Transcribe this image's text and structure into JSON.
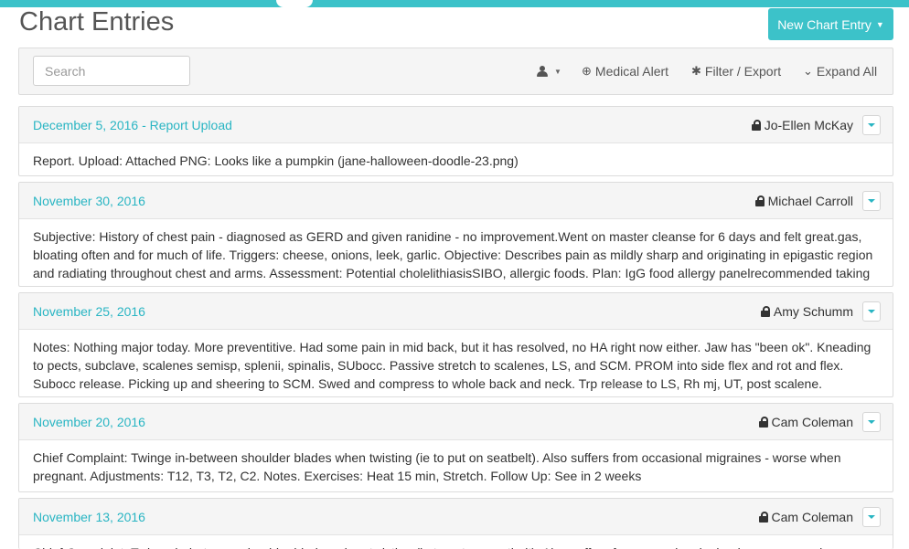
{
  "header": {
    "title": "Chart Entries",
    "new_entry_label": "New Chart Entry"
  },
  "toolbar": {
    "search_placeholder": "Search",
    "user_filter_icon": "user-icon",
    "medical_alert_label": "Medical Alert",
    "filter_export_label": "Filter / Export",
    "expand_all_label": "Expand All"
  },
  "colors": {
    "accent": "#3cc2c9",
    "link": "#29b5c3"
  },
  "entries": [
    {
      "date": "December 5, 2016 - Report Upload",
      "author": "Jo-Ellen McKay",
      "body": "Report. Upload: Attached PNG: Looks like a pumpkin (jane-halloween-doodle-23.png)"
    },
    {
      "date": "November 30, 2016",
      "author": "Michael Carroll",
      "body": "Subjective: History of chest pain - diagnosed as GERD and given ranidine - no improvement.Went on master cleanse for 6 days and felt great.gas, bloating often and for much of life. Triggers: cheese, onions, leek, garlic. Objective: Describes pain as mildly sharp and originating in epigastic region and radiating throughout chest and arms. Assessment: Potential cholelithiasisSIBO, allergic foods. Plan: IgG food allergy panelrecommended taking"
    },
    {
      "date": "November 25, 2016",
      "author": "Amy Schumm",
      "body": "Notes: Nothing major today. More preventitive. Had some pain in mid back, but it has resolved, no HA right now either. Jaw has \"been ok\". Kneading to pects, subclave, scalenes semisp, splenii, spinalis, SUbocc. Passive stretch to scalenes, LS, and SCM. PROM into side flex and rot and flex. Subocc release. Picking up and sheering to SCM. Swed and compress to whole back and neck. Trp release to LS, Rh mj, UT, post scalene. Stripping, Kneading"
    },
    {
      "date": "November 20, 2016",
      "author": "Cam Coleman",
      "body": "Chief Complaint: Twinge in-between shoulder blades when twisting (ie to put on seatbelt). Also suffers from occasional migraines - worse when pregnant. Adjustments: T12, T3, T2, C2. Notes. Exercises: Heat 15 min, Stretch. Follow Up: See in 2 weeks"
    },
    {
      "date": "November 13, 2016",
      "author": "Cam Coleman",
      "body": "Chief Complaint: Twinge in-between shoulder blades when twisting (ie to put on seatbelt). Also suffers from occasional migraines - worse when pregnant."
    }
  ]
}
